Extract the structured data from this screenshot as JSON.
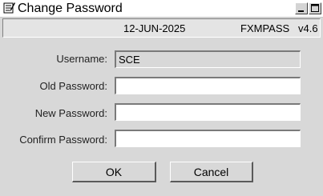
{
  "window": {
    "title": "Change Password",
    "icon": "pencil-notepad-icon",
    "minimize_label": "minimize-icon",
    "maximize_label": "maximize-icon"
  },
  "infobar": {
    "date": "12-JUN-2025",
    "app_code": "FXMPASS",
    "version": "v4.6"
  },
  "form": {
    "username_label": "Username:",
    "username_value": "SCE",
    "old_password_label": "Old Password:",
    "old_password_value": "",
    "new_password_label": "New Password:",
    "new_password_value": "",
    "confirm_password_label": "Confirm Password:",
    "confirm_password_value": ""
  },
  "buttons": {
    "ok_label": "OK",
    "cancel_label": "Cancel"
  },
  "colors": {
    "window_bg": "#d8d8d8",
    "titlebar_bg": "#ffffff",
    "field_bg": "#ffffff",
    "readonly_bg": "#d8d8d8"
  }
}
